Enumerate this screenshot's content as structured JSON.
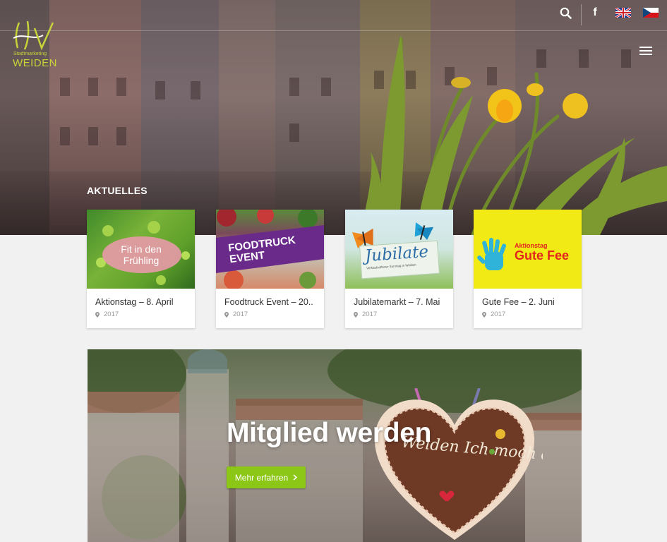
{
  "header": {
    "logo_small": "Stadtmarketing",
    "logo_big": "WEIDEN",
    "icons": [
      "search-icon",
      "facebook-icon",
      "flag-uk-icon",
      "flag-cz-icon",
      "menu-icon"
    ],
    "facebook_glyph": "f"
  },
  "news": {
    "section_title": "AKTUELLES",
    "items": [
      {
        "title": "Aktionstag – 8. April",
        "meta": "2017",
        "thumb_text": "Fit in den Frühling"
      },
      {
        "title": "Foodtruck Event – 20..",
        "meta": "2017",
        "thumb_text": "FOODTRUCK EVENT"
      },
      {
        "title": "Jubilatemarkt – 7. Mai",
        "meta": "2017",
        "thumb_text": "Jubilate",
        "thumb_subtext": "Verkaufsoffener Sonntag in Weiden"
      },
      {
        "title": "Gute Fee – 2. Juni",
        "meta": "2017",
        "thumb_text_small": "Aktionstag",
        "thumb_text": "Gute Fee"
      }
    ]
  },
  "cta": {
    "heading": "Mitglied werden",
    "button_label": "Mehr erfahren",
    "heart_text": "Weiden Ich moch de"
  },
  "colors": {
    "accent_green": "#8cc617",
    "logo_green": "#c6d43a"
  }
}
